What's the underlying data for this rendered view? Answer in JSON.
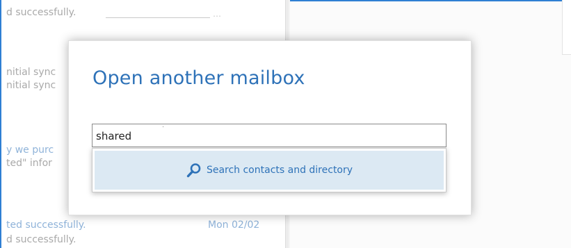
{
  "background_list": {
    "rows": [
      {
        "text": "d successfully.",
        "kind": "grey"
      },
      {
        "text": "nitial sync",
        "kind": "grey"
      },
      {
        "text": "nitial sync",
        "kind": "grey"
      },
      {
        "text": "y we purc",
        "kind": "blue"
      },
      {
        "text": "ted\" infor",
        "kind": "grey"
      },
      {
        "text": "ted successfully.",
        "kind": "blue"
      },
      {
        "text": "d successfully.",
        "kind": "grey"
      }
    ],
    "date_label": "Mon 02/02"
  },
  "dialog": {
    "title": "Open another mailbox",
    "search_input": {
      "value": "shared",
      "placeholder": ""
    },
    "suggestion": {
      "label": "Search contacts and directory",
      "icon": "search-icon"
    }
  },
  "colors": {
    "accent": "#2e72b8",
    "suggestion_bg": "#dce9f3",
    "left_border": "#2f7fd3"
  }
}
